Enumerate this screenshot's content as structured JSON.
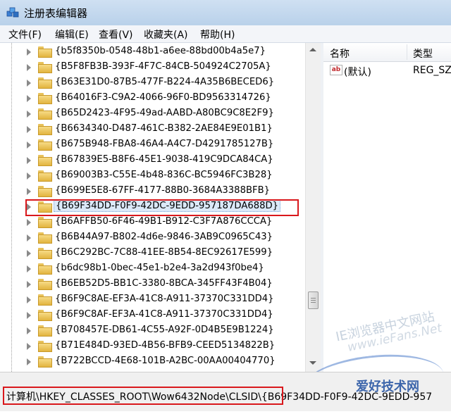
{
  "window": {
    "title": "注册表编辑器",
    "icon": "regedit-icon"
  },
  "menu": [
    {
      "label": "文件(F)"
    },
    {
      "label": "编辑(E)"
    },
    {
      "label": "查看(V)"
    },
    {
      "label": "收藏夹(A)"
    },
    {
      "label": "帮助(H)"
    }
  ],
  "tree": {
    "items": [
      {
        "label": "{b5f8350b-0548-48b1-a6ee-88bd00b4a5e7}"
      },
      {
        "label": "{B5F8FB3B-393F-4F7C-84CB-504924C2705A}"
      },
      {
        "label": "{B63E31D0-87B5-477F-B224-4A35B6BECED6}"
      },
      {
        "label": "{B64016F3-C9A2-4066-96F0-BD9563314726}"
      },
      {
        "label": "{B65D2423-4F95-49ad-AABD-A80BC9C8E2F9}"
      },
      {
        "label": "{B6634340-D487-461C-B382-2AE84E9E01B1}"
      },
      {
        "label": "{B675B948-FBA8-46A4-A4C7-D4291785127B}"
      },
      {
        "label": "{B67839E5-B8F6-45E1-9038-419C9DCA84CA}"
      },
      {
        "label": "{B69003B3-C55E-4b48-836C-BC5946FC3B28}"
      },
      {
        "label": "{B699E5E8-67FF-4177-88B0-3684A3388BFB}"
      },
      {
        "label": "{B69F34DD-F0F9-42DC-9EDD-957187DA688D}",
        "selected": true
      },
      {
        "label": "{B6AFFB50-6F46-49B1-B912-C3F7A876CCCA}"
      },
      {
        "label": "{B6B44A97-B802-4d6e-9846-3AB9C0965C43}"
      },
      {
        "label": "{B6C292BC-7C88-41EE-8B54-8EC92617E599}"
      },
      {
        "label": "{b6dc98b1-0bec-45e1-b2e4-3a2d943f0be4}"
      },
      {
        "label": "{B6EB52D5-BB1C-3380-8BCA-345FF43F4B04}"
      },
      {
        "label": "{B6F9C8AE-EF3A-41C8-A911-37370C331DD4}"
      },
      {
        "label": "{B6F9C8AF-EF3A-41C8-A911-37370C331DD4}"
      },
      {
        "label": "{B708457E-DB61-4C55-A92F-0D4B5E9B1224}"
      },
      {
        "label": "{B71E484D-93ED-4B56-BFB9-CEED5134822B}"
      },
      {
        "label": "{B722BCCD-4E68-101B-A2BC-00AA00404770}"
      }
    ]
  },
  "list": {
    "columns": [
      "名称",
      "类型"
    ],
    "rows": [
      {
        "name": "(默认)",
        "type": "REG_SZ",
        "icon": "string-value-icon"
      }
    ]
  },
  "watermark": {
    "line1": "IE浏览器中文网站",
    "line2": "www.ieFans.Net",
    "logo": "爱好技术网"
  },
  "status": {
    "path": "计算机\\HKEY_CLASSES_ROOT\\Wow6432Node\\CLSID\\{B69F34DD-F0F9-42DC-9EDD-957"
  },
  "colors": {
    "highlight_box": "#d9181c",
    "selected_bg": "#dbe9f8"
  }
}
